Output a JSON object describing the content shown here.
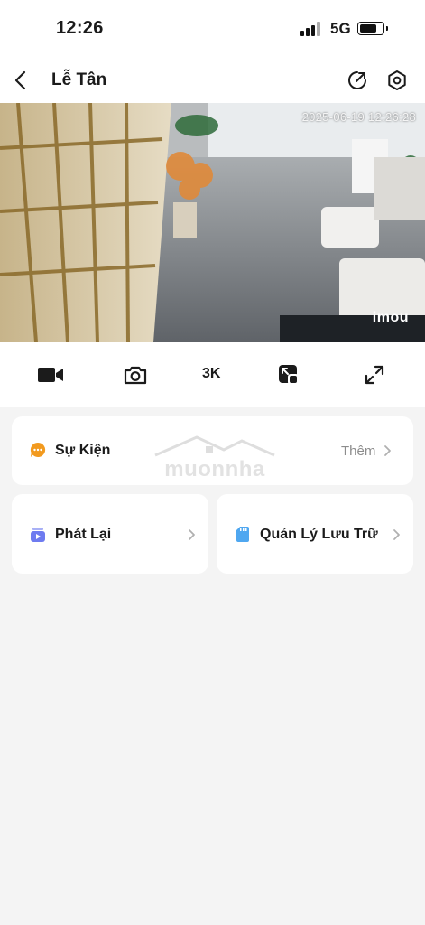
{
  "status": {
    "time": "12:26",
    "network": "5G",
    "battery_level": 0.8
  },
  "nav": {
    "title": "Lễ Tân",
    "back_icon": "chevron-left-icon",
    "share_icon": "share-icon",
    "settings_icon": "settings-icon"
  },
  "video": {
    "timestamp": "2025-06-19 12:26:28",
    "logo": "imou"
  },
  "controls": {
    "record_icon": "video-record-icon",
    "snapshot_icon": "camera-icon",
    "quality": "3K",
    "pip_icon": "picture-in-picture-icon",
    "fullscreen_icon": "fullscreen-icon"
  },
  "events": {
    "label": "Sự Kiện",
    "more": "Thêm",
    "icon": "chat-bubble-icon",
    "icon_color": "#F29A1F"
  },
  "playback": {
    "label": "Phát Lại",
    "icon": "playback-icon",
    "icon_color": "#6E7BF0"
  },
  "storage": {
    "label": "Quản Lý Lưu Trữ",
    "icon": "sd-card-icon",
    "icon_color": "#4FA7F0"
  },
  "watermark": {
    "text": "muonnha"
  }
}
